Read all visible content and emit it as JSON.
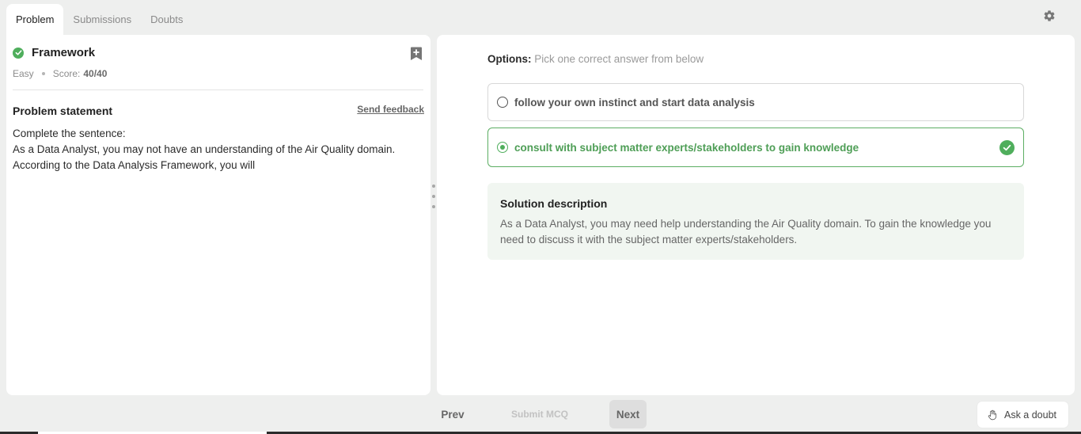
{
  "tabs": [
    {
      "label": "Problem",
      "active": true
    },
    {
      "label": "Submissions",
      "active": false
    },
    {
      "label": "Doubts",
      "active": false
    }
  ],
  "problem": {
    "title": "Framework",
    "difficulty": "Easy",
    "score_label": "Score:",
    "score_value": "40/40",
    "statement_heading": "Problem statement",
    "feedback_link": "Send feedback",
    "statement_line1": "Complete the sentence:",
    "statement_line2": "As a Data Analyst, you may not have an understanding of the Air Quality domain. According to the Data Analysis Framework, you will"
  },
  "options": {
    "label": "Options:",
    "hint": "Pick one correct answer from below",
    "items": [
      {
        "text": "follow your own instinct and start data analysis",
        "selected": false,
        "correct": false
      },
      {
        "text": "consult with subject matter experts/stakeholders to gain knowledge",
        "selected": true,
        "correct": true
      }
    ]
  },
  "solution": {
    "title": "Solution description",
    "body": "As a Data Analyst, you may need help understanding the Air Quality domain. To gain the knowledge you need to discuss it with the subject matter experts/stakeholders."
  },
  "footer": {
    "prev": "Prev",
    "submit": "Submit MCQ",
    "next": "Next",
    "ask": "Ask a doubt"
  },
  "colors": {
    "accent_green": "#4fae5c",
    "background": "#eeefee",
    "panel": "#ffffff"
  },
  "icons": {
    "settings": "gear-icon",
    "bookmark": "bookmark-plus-icon",
    "solved": "check-circle-icon",
    "ask": "hand-icon"
  }
}
